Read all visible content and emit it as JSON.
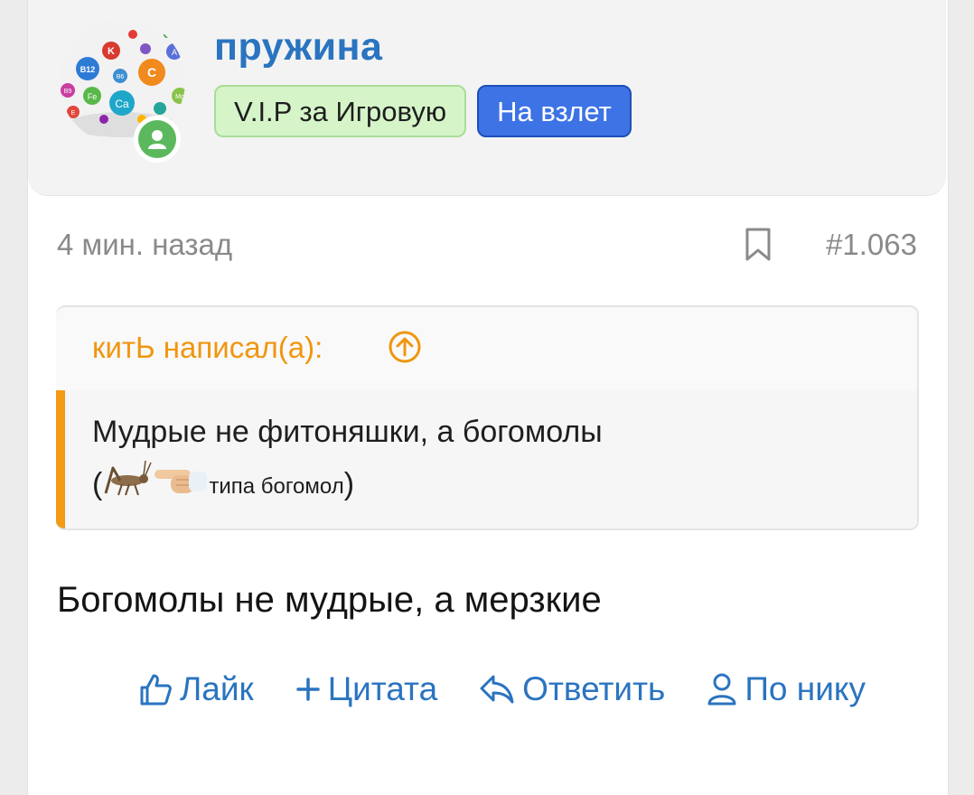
{
  "post": {
    "username": "пружина",
    "badges": [
      "V.I.P за Игровую",
      "На взлет"
    ],
    "time": "4 мин. назад",
    "number": "#1.063",
    "quote": {
      "author": "китЬ написал(а):",
      "line1": "Мудрые не фитоняшки, а богомолы",
      "line2_open": "(",
      "line2_text": "типа богомол",
      "line2_close": ")"
    },
    "message": "Богомолы не мудрые, а мерзкие"
  },
  "avatar_labels": {
    "b12": "B12",
    "k": "K",
    "c": "C",
    "a": "A",
    "ca": "Ca",
    "fe": "Fe",
    "b6": "B6",
    "b9": "B9",
    "e": "E",
    "mg": "Mg",
    "b1": "B1"
  },
  "actions": {
    "like": "Лайк",
    "quote": "Цитата",
    "reply": "Ответить",
    "by_nick": "По нику"
  },
  "colors": {
    "link_blue": "#2a74c0",
    "quote_orange": "#f39b12",
    "badge_vip_bg": "#d5f5c9",
    "badge_launch_bg": "#3e73e6",
    "online_green": "#5cb85c"
  },
  "icons": {
    "online": "user-icon",
    "bookmark": "bookmark-icon",
    "quote_jump": "arrow-up-circle-icon",
    "like": "thumbs-up-icon",
    "quote": "plus-icon",
    "reply": "reply-icon",
    "by_nick": "user-outline-icon",
    "grasshopper": "grasshopper-emoji",
    "pointing": "pointing-hand-emoji"
  }
}
